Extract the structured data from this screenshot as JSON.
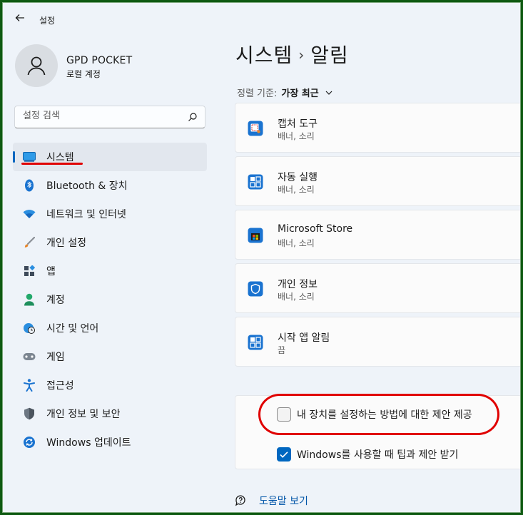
{
  "window": {
    "title": "설정"
  },
  "profile": {
    "name": "GPD POCKET",
    "account_type": "로컬 계정"
  },
  "search": {
    "placeholder": "설정 검색"
  },
  "sidebar": {
    "items": [
      {
        "label": "시스템",
        "icon": "monitor-icon",
        "active": true
      },
      {
        "label": "Bluetooth & 장치",
        "icon": "bluetooth-icon"
      },
      {
        "label": "네트워크 및 인터넷",
        "icon": "wifi-icon"
      },
      {
        "label": "개인 설정",
        "icon": "brush-icon"
      },
      {
        "label": "앱",
        "icon": "apps-icon"
      },
      {
        "label": "계정",
        "icon": "person-icon"
      },
      {
        "label": "시간 및 언어",
        "icon": "globe-clock-icon"
      },
      {
        "label": "게임",
        "icon": "gamepad-icon"
      },
      {
        "label": "접근성",
        "icon": "accessibility-icon"
      },
      {
        "label": "개인 정보 및 보안",
        "icon": "shield-icon"
      },
      {
        "label": "Windows 업데이트",
        "icon": "update-icon"
      }
    ]
  },
  "main": {
    "breadcrumb_parent": "시스템",
    "breadcrumb_separator": "›",
    "breadcrumb_current": "알림",
    "sort_label": "정렬 기준:",
    "sort_value": "가장 최근",
    "apps": [
      {
        "name": "캡처 도구",
        "detail": "배너, 소리",
        "icon": "snipping-tool-icon"
      },
      {
        "name": "자동 실행",
        "detail": "배너, 소리",
        "icon": "autoplay-icon"
      },
      {
        "name": "Microsoft Store",
        "detail": "배너, 소리",
        "icon": "store-icon"
      },
      {
        "name": "개인 정보",
        "detail": "배너, 소리",
        "icon": "privacy-shield-icon"
      },
      {
        "name": "시작 앱 알림",
        "detail": "끔",
        "icon": "startup-apps-icon"
      }
    ],
    "options": [
      {
        "label": "내 장치를 설정하는 방법에 대한 제안 제공",
        "checked": false
      },
      {
        "label": "Windows를 사용할 때 팁과 제안 받기",
        "checked": true
      }
    ],
    "help_link": "도움말 보기"
  },
  "colors": {
    "accent": "#0067c0",
    "highlight": "#e00000",
    "background": "#eef3f9"
  }
}
